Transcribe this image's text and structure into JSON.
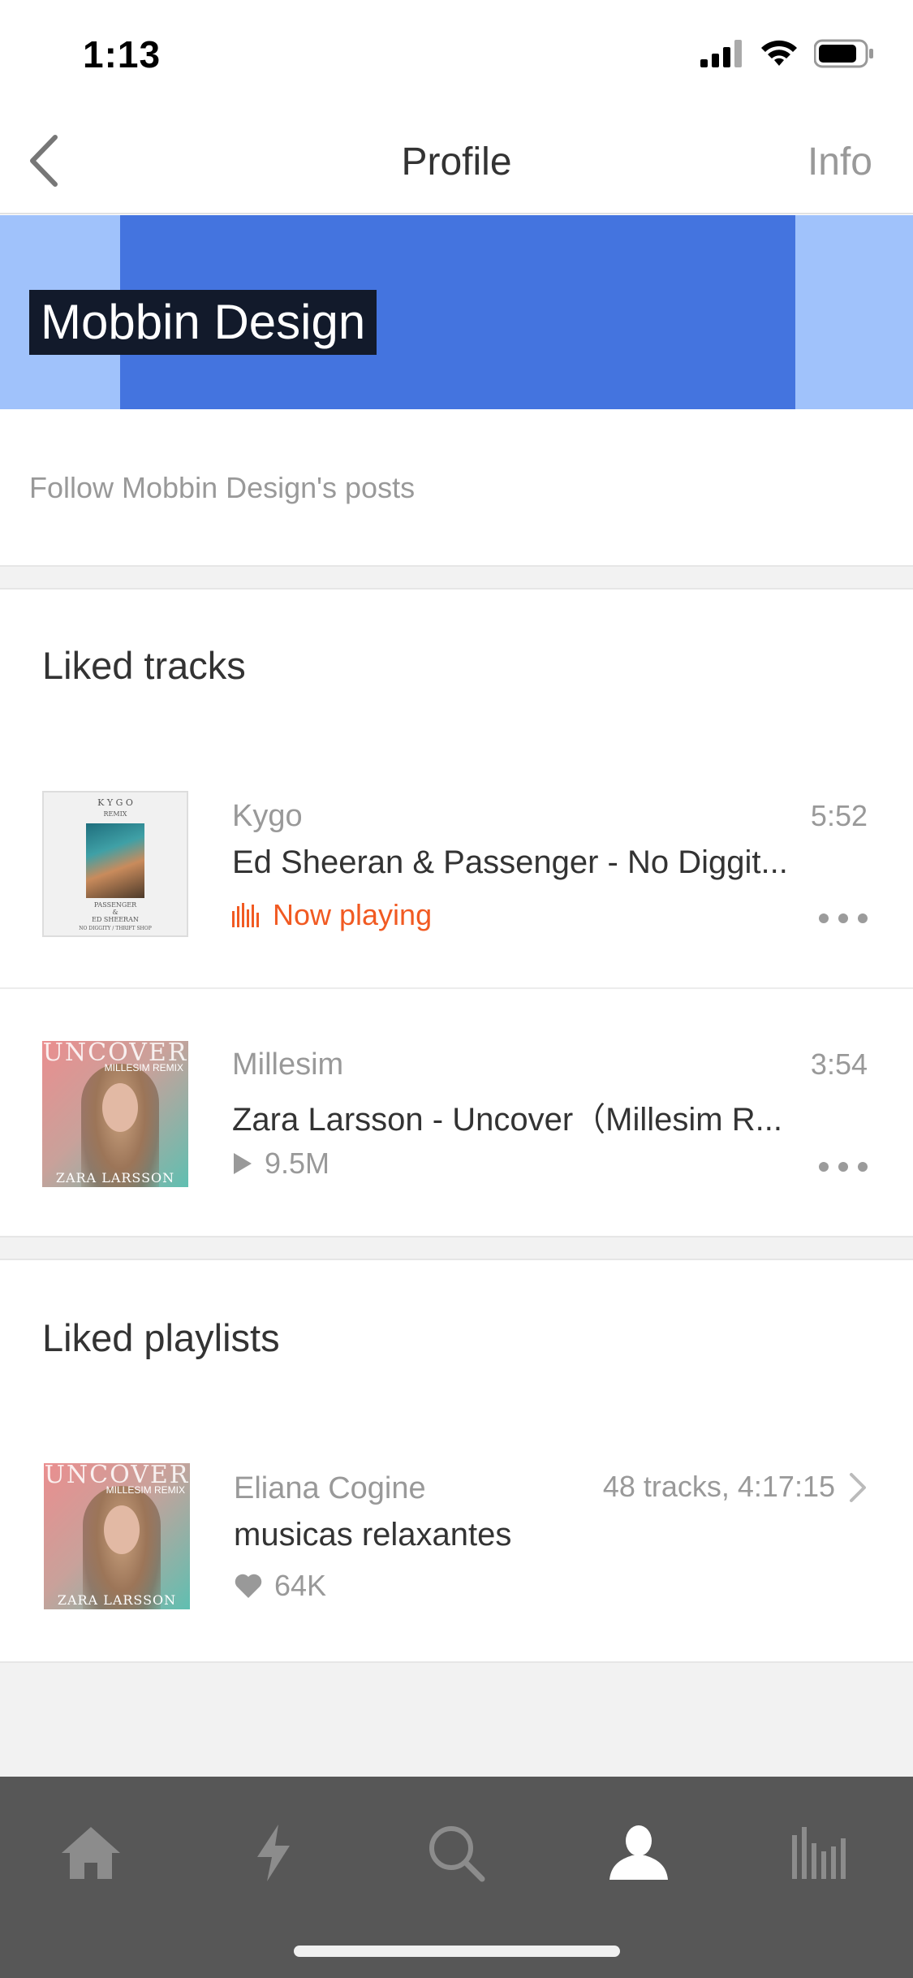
{
  "status_bar": {
    "time": "1:13"
  },
  "nav": {
    "title": "Profile",
    "info_label": "Info"
  },
  "banner": {
    "name": "Mobbin Design",
    "colors": {
      "outer": "#a0c2fb",
      "inner": "#4474df"
    }
  },
  "follow": {
    "text": "Follow Mobbin Design's posts"
  },
  "liked_tracks": {
    "title": "Liked tracks",
    "items": [
      {
        "artist": "Kygo",
        "title": "Ed Sheeran & Passenger - No Diggit...",
        "duration": "5:52",
        "status": "Now playing",
        "art": {
          "top_text": "K Y G O",
          "sub": "REMIX",
          "bottom1": "PASSENGER",
          "bottom2": "&",
          "bottom3": "ED SHEERAN",
          "bottom4": "NO DIGGITY / THRIFT SHOP"
        }
      },
      {
        "artist": "Millesim",
        "title": "Zara Larsson - Uncover（Millesim R...",
        "duration": "3:54",
        "plays": "9.5M",
        "art": {
          "top": "UNCOVER",
          "sub": "MILLESIM REMIX",
          "bottom": "ZARA LARSSON"
        }
      }
    ]
  },
  "liked_playlists": {
    "title": "Liked playlists",
    "items": [
      {
        "owner": "Eliana Cogine",
        "title": "musicas relaxantes",
        "meta": "48 tracks, 4:17:15",
        "likes": "64K",
        "art": {
          "top": "UNCOVER",
          "sub": "MILLESIM REMIX",
          "bottom": "ZARA LARSSON"
        }
      }
    ]
  },
  "accent_color": "#f15a22",
  "tab_bar": {
    "active": "profile",
    "tabs": [
      "home-icon",
      "stream-icon",
      "search-icon",
      "profile-icon",
      "library-icon"
    ]
  }
}
